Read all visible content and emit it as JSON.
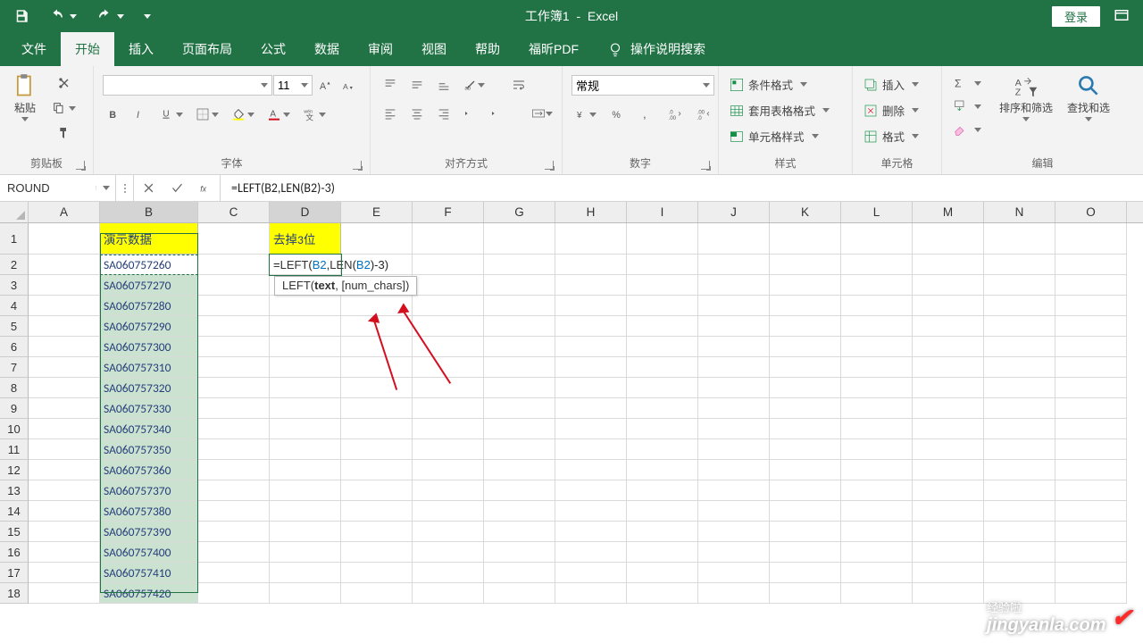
{
  "title": {
    "doc": "工作簿1",
    "sep": "-",
    "app": "Excel"
  },
  "login": "登录",
  "tabs": [
    "文件",
    "开始",
    "插入",
    "页面布局",
    "公式",
    "数据",
    "审阅",
    "视图",
    "帮助",
    "福昕PDF"
  ],
  "active_tab": 1,
  "tell_me": "操作说明搜索",
  "ribbon": {
    "clipboard": {
      "paste": "粘贴",
      "label": "剪贴板"
    },
    "font": {
      "font_name": "",
      "font_size": "11",
      "label": "字体"
    },
    "align": {
      "label": "对齐方式"
    },
    "number": {
      "format": "常规",
      "label": "数字"
    },
    "styles": {
      "cond": "条件格式",
      "table": "套用表格格式",
      "cell": "单元格样式",
      "label": "样式"
    },
    "cells": {
      "insert": "插入",
      "delete": "删除",
      "format": "格式",
      "label": "单元格"
    },
    "editing": {
      "sort": "排序和筛选",
      "find": "查找和选",
      "label": "编辑"
    }
  },
  "namebox": "ROUND",
  "formula": "=LEFT(B2,LEN(B2)-3)",
  "columns": [
    "A",
    "B",
    "C",
    "D",
    "E",
    "F",
    "G",
    "H",
    "I",
    "J",
    "K",
    "L",
    "M",
    "N",
    "O"
  ],
  "col_b_w": 110,
  "col_d_w": 80,
  "headers": {
    "b1": "演示数据",
    "d1": "去掉3位"
  },
  "data_b": [
    "SA060757260",
    "SA060757270",
    "SA060757280",
    "SA060757290",
    "SA060757300",
    "SA060757310",
    "SA060757320",
    "SA060757330",
    "SA060757340",
    "SA060757350",
    "SA060757360",
    "SA060757370",
    "SA060757380",
    "SA060757390",
    "SA060757400",
    "SA060757410",
    "SA060757420"
  ],
  "edit_cell_parts": {
    "eq": "=",
    "fn": "LEFT",
    "lp": "(",
    "r1": "B2",
    "comma": ",",
    "fn2": "LEN",
    "lp2": "(",
    "r2": "B2",
    "rp2": ")",
    "tail": "-3)"
  },
  "tooltip": {
    "pre": "LEFT(",
    "arg1": "text",
    "rest": ", [num_chars])"
  },
  "watermark": {
    "cn": "经验啦",
    "en": "jingyanla.com"
  }
}
